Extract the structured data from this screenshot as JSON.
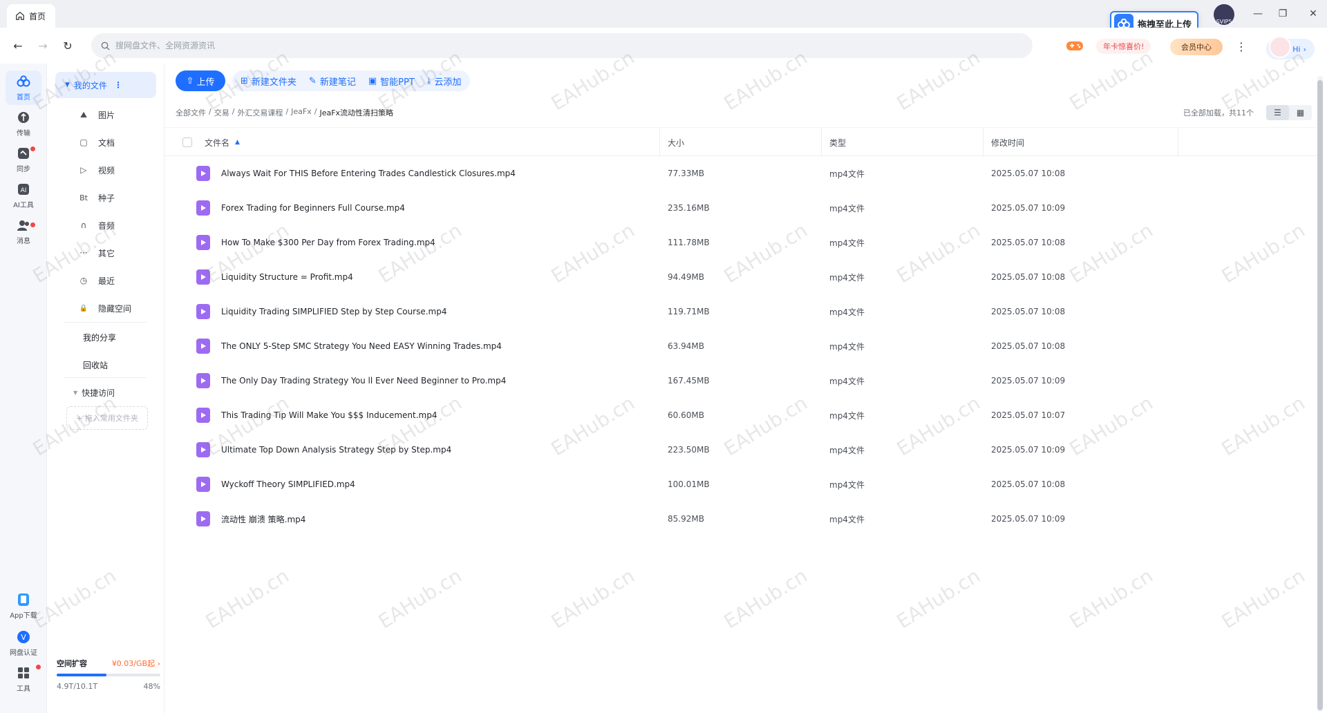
{
  "window": {
    "tab_title": "首页",
    "minimize": "—",
    "restore": "❐",
    "close": "✕"
  },
  "address": {
    "search_placeholder": "搜网盘文件、全网资源资讯"
  },
  "topbar": {
    "drag_tip": "拖拽至此上传",
    "promo": "年卡惊喜价!",
    "vip_center": "会员中心",
    "more": "⋮",
    "hi": "Hi",
    "hi_chevron": "›",
    "user_badge": "SVIP5"
  },
  "rail": {
    "items": [
      {
        "label": "首页",
        "icon": "cloud-icon"
      },
      {
        "label": "传输",
        "icon": "transfer-icon"
      },
      {
        "label": "同步",
        "icon": "sync-icon"
      },
      {
        "label": "AI工具",
        "icon": "ai-icon"
      },
      {
        "label": "消息",
        "icon": "message-icon"
      }
    ],
    "bottom": [
      {
        "label": "App下载",
        "icon": "phone-icon"
      },
      {
        "label": "网盘认证",
        "icon": "verify-icon"
      },
      {
        "label": "工具",
        "icon": "tools-icon"
      }
    ]
  },
  "sidebar": {
    "my_files": "我的文件",
    "items": [
      {
        "label": "图片",
        "icon": "image-icon",
        "glyph": "⛰"
      },
      {
        "label": "文档",
        "icon": "document-icon",
        "glyph": "▢"
      },
      {
        "label": "视频",
        "icon": "video-icon",
        "glyph": "▷"
      },
      {
        "label": "种子",
        "icon": "torrent-icon",
        "glyph": "Bt"
      },
      {
        "label": "音频",
        "icon": "audio-icon",
        "glyph": "∩"
      },
      {
        "label": "其它",
        "icon": "other-icon",
        "glyph": "···"
      },
      {
        "label": "最近",
        "icon": "recent-icon",
        "glyph": "◷"
      },
      {
        "label": "隐藏空间",
        "icon": "lock-icon",
        "glyph": "🔒"
      }
    ],
    "my_share": "我的分享",
    "recycle": "回收站",
    "quick_access": "快捷访问",
    "quick_add": "+ 拖入常用文件夹",
    "quota_title": "空间扩容",
    "quota_price": "¥0.03/GB起",
    "quota_chevron": "›",
    "quota_used": "4.9T/10.1T",
    "quota_percent": "48%",
    "quota_fraction": 0.48
  },
  "toolbar": {
    "upload": "上传",
    "new_folder": "新建文件夹",
    "new_note": "新建笔记",
    "smart_ppt": "智能PPT",
    "cloud_add": "云添加"
  },
  "breadcrumb": [
    "全部文件",
    "交易",
    "外汇交易课程",
    "JeaFx",
    "JeaFx流动性清扫策略"
  ],
  "breadcrumb_sep": "/",
  "loaded_text": "已全部加载，共11个",
  "columns": {
    "name": "文件名",
    "size": "大小",
    "type": "类型",
    "modified": "修改时间"
  },
  "files": [
    {
      "name": "Always Wait For THIS Before Entering Trades Candlestick Closures.mp4",
      "size": "77.33MB",
      "type": "mp4文件",
      "modified": "2025.05.07 10:08"
    },
    {
      "name": "Forex Trading for Beginners Full Course.mp4",
      "size": "235.16MB",
      "type": "mp4文件",
      "modified": "2025.05.07 10:09"
    },
    {
      "name": "How To Make $300 Per Day from Forex Trading.mp4",
      "size": "111.78MB",
      "type": "mp4文件",
      "modified": "2025.05.07 10:08"
    },
    {
      "name": "Liquidity Structure = Profit.mp4",
      "size": "94.49MB",
      "type": "mp4文件",
      "modified": "2025.05.07 10:08"
    },
    {
      "name": "Liquidity Trading SIMPLIFIED Step by Step Course.mp4",
      "size": "119.71MB",
      "type": "mp4文件",
      "modified": "2025.05.07 10:08"
    },
    {
      "name": "The ONLY 5-Step SMC Strategy You Need EASY Winning Trades.mp4",
      "size": "63.94MB",
      "type": "mp4文件",
      "modified": "2025.05.07 10:08"
    },
    {
      "name": "The Only Day Trading Strategy You ll Ever Need Beginner to Pro.mp4",
      "size": "167.45MB",
      "type": "mp4文件",
      "modified": "2025.05.07 10:09"
    },
    {
      "name": "This Trading Tip Will Make You $$$ Inducement.mp4",
      "size": "60.60MB",
      "type": "mp4文件",
      "modified": "2025.05.07 10:07"
    },
    {
      "name": "Ultimate Top Down Analysis Strategy Step by Step.mp4",
      "size": "223.50MB",
      "type": "mp4文件",
      "modified": "2025.05.07 10:09"
    },
    {
      "name": "Wyckoff Theory SIMPLIFIED.mp4",
      "size": "100.01MB",
      "type": "mp4文件",
      "modified": "2025.05.07 10:08"
    },
    {
      "name": "流动性 崩溃 策略.mp4",
      "size": "85.92MB",
      "type": "mp4文件",
      "modified": "2025.05.07 10:09"
    }
  ],
  "watermark_text": "EAHub.cn",
  "colors": {
    "accent": "#1e6fff",
    "video_icon": "#9d6bf2",
    "alert": "#f04848"
  }
}
